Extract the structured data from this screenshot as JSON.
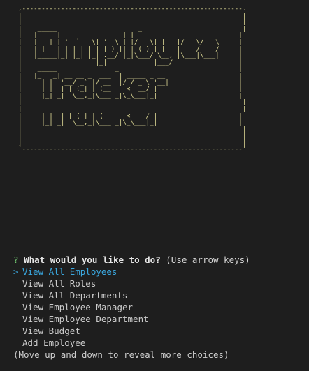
{
  "banner": {
    "ascii_art": ",---------------------------------------------------------.\n|                                                         |\n|                                                         |\n|    _____                     _                          |\n|   |  ___|_ __ ___  _ __  | | ___  _   _  ___  ___      |\n|   |  _| | '_ ` _ \\| '_ \\ | |/ _ \\| | | |/ _ \\/ _ \\     |\n|   | |___| | | | | | |_) || | (_) | |_| |  __/  __/     |\n|   |_____|_| |_| |_| .__/ |_|\\___/ \\__, |\\___|\\___|     |\n|                   |_|            |___/                 |\n|    _____               _                               |\n|   |_   _| __ __ _  ___| | _____ _ __                   |\n|     | || '__/ _` |/ __| |/ / _ \\ '__|                  |\n|     | || | | (_| | (__|   <  __/ |                     |\n|     |_||_|  \\__,_|\\___|_|\\_\\___|_|                     |\n|                                                         |\n|                                                         |\n|     | || | | (_| | (__|   <  __/ |                     |\n|     |_||_|  \\__,_|\\___|_|\\_\\___|_|                     |\n|                                                         |\n|                                                         |\n|                                                         |\n`---------------------------------------------------------'"
  },
  "prompt": {
    "marker": "?",
    "question": "What would you like to do?",
    "hint": "(Use arrow keys)"
  },
  "menu": {
    "cursor": ">",
    "items": [
      {
        "label": "View All Employees"
      },
      {
        "label": "View All Roles"
      },
      {
        "label": "View All Departments"
      },
      {
        "label": "View Employee Manager"
      },
      {
        "label": "View Employee Department"
      },
      {
        "label": "View Budget"
      },
      {
        "label": "Add Employee"
      }
    ]
  },
  "footer": {
    "text": "(Move up and down to reveal more choices)"
  },
  "colors": {
    "background": "#1e1e1e",
    "banner": "#e4df9a",
    "prompt_marker": "#6fc36f",
    "selected": "#3aa8e0",
    "text": "#cccccc"
  }
}
